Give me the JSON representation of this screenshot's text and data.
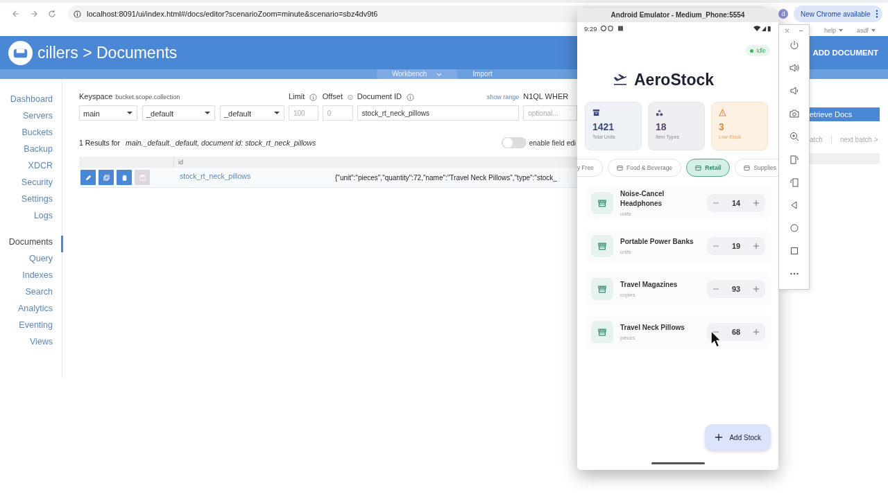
{
  "browser": {
    "url": "localhost:8091/ui/index.html#/docs/editor?scenarioZoom=minute&scenario=sbz4dv9t6",
    "profile_initial": "d",
    "update_notice": "New Chrome available"
  },
  "top_menu": [
    "help",
    "asdf"
  ],
  "header": {
    "root": "cillers",
    "separator": ">",
    "title": "Documents",
    "action": "ADD DOCUMENT"
  },
  "subnav": [
    {
      "label": "Workbench",
      "has_menu": true,
      "selected": true
    },
    {
      "label": "Import",
      "has_menu": false,
      "selected": false
    }
  ],
  "sidebar": {
    "groups": [
      [
        {
          "label": "Dashboard",
          "selected": false
        },
        {
          "label": "Servers",
          "selected": false
        },
        {
          "label": "Buckets",
          "selected": false
        },
        {
          "label": "Backup",
          "selected": false
        },
        {
          "label": "XDCR",
          "selected": false
        },
        {
          "label": "Security",
          "selected": false
        },
        {
          "label": "Settings",
          "selected": false
        },
        {
          "label": "Logs",
          "selected": false
        }
      ],
      [
        {
          "label": "Documents",
          "selected": true
        },
        {
          "label": "Query",
          "selected": false
        },
        {
          "label": "Indexes",
          "selected": false
        },
        {
          "label": "Search",
          "selected": false
        },
        {
          "label": "Analytics",
          "selected": false
        },
        {
          "label": "Eventing",
          "selected": false
        },
        {
          "label": "Views",
          "selected": false
        }
      ]
    ]
  },
  "filters": {
    "keyspace_label": "Keyspace",
    "keyspace_hint": "bucket.scope.collection",
    "selects": [
      "main",
      "_default",
      "_default"
    ],
    "limit": {
      "label": "Limit",
      "placeholder": "100"
    },
    "offset": {
      "label": "Offset",
      "placeholder": "0"
    },
    "document_id": {
      "label": "Document ID",
      "value": "stock_rt_neck_pillows"
    },
    "range_link": "show range",
    "where": {
      "label": "N1QL WHER",
      "placeholder": "optional..."
    },
    "retrieve_button": "etrieve Docs"
  },
  "results": {
    "count": "1 Results for",
    "detail": "main._default._default, document id: stock_rt_neck_pillows",
    "field_edit": {
      "label": "enable field edi",
      "on": false
    },
    "batch_prev": "atch",
    "batch_next": "next batch >"
  },
  "table": {
    "columns": [
      "id"
    ],
    "rows": [
      {
        "id": "stock_rt_neck_pillows",
        "json": "{\"unit\":\"pieces\",\"quantity\":72,\"name\":\"Travel Neck Pillows\",\"type\":\"stock_",
        "actions": [
          {
            "kind": "edit",
            "disabled": false
          },
          {
            "kind": "copy",
            "disabled": false
          },
          {
            "kind": "delete",
            "disabled": false
          },
          {
            "kind": "save",
            "disabled": true
          }
        ]
      }
    ]
  },
  "emulator": {
    "title": "Android Emulator - Medium_Phone:5554"
  },
  "phone": {
    "time": "9:29",
    "status": "Idle",
    "app_title": "AeroStock",
    "stats": [
      {
        "kind": "total",
        "value": "1421",
        "label": "Total Units"
      },
      {
        "kind": "types",
        "value": "18",
        "label": "Item Types"
      },
      {
        "kind": "low",
        "value": "3",
        "label": "Low Stock"
      }
    ],
    "categories": [
      {
        "label": "y Free",
        "selected": false
      },
      {
        "label": "Food & Beverage",
        "selected": false
      },
      {
        "label": "Retail",
        "selected": true
      },
      {
        "label": "Supplies",
        "selected": false
      }
    ],
    "items": [
      {
        "name": "Noise-Cancel Headphones",
        "unit": "units",
        "quantity": "14"
      },
      {
        "name": "Portable Power Banks",
        "unit": "units",
        "quantity": "19"
      },
      {
        "name": "Travel Magazines",
        "unit": "copies",
        "quantity": "93"
      },
      {
        "name": "Travel Neck Pillows",
        "unit": "pieces",
        "quantity": "68"
      }
    ],
    "add_button": "Add Stock"
  }
}
